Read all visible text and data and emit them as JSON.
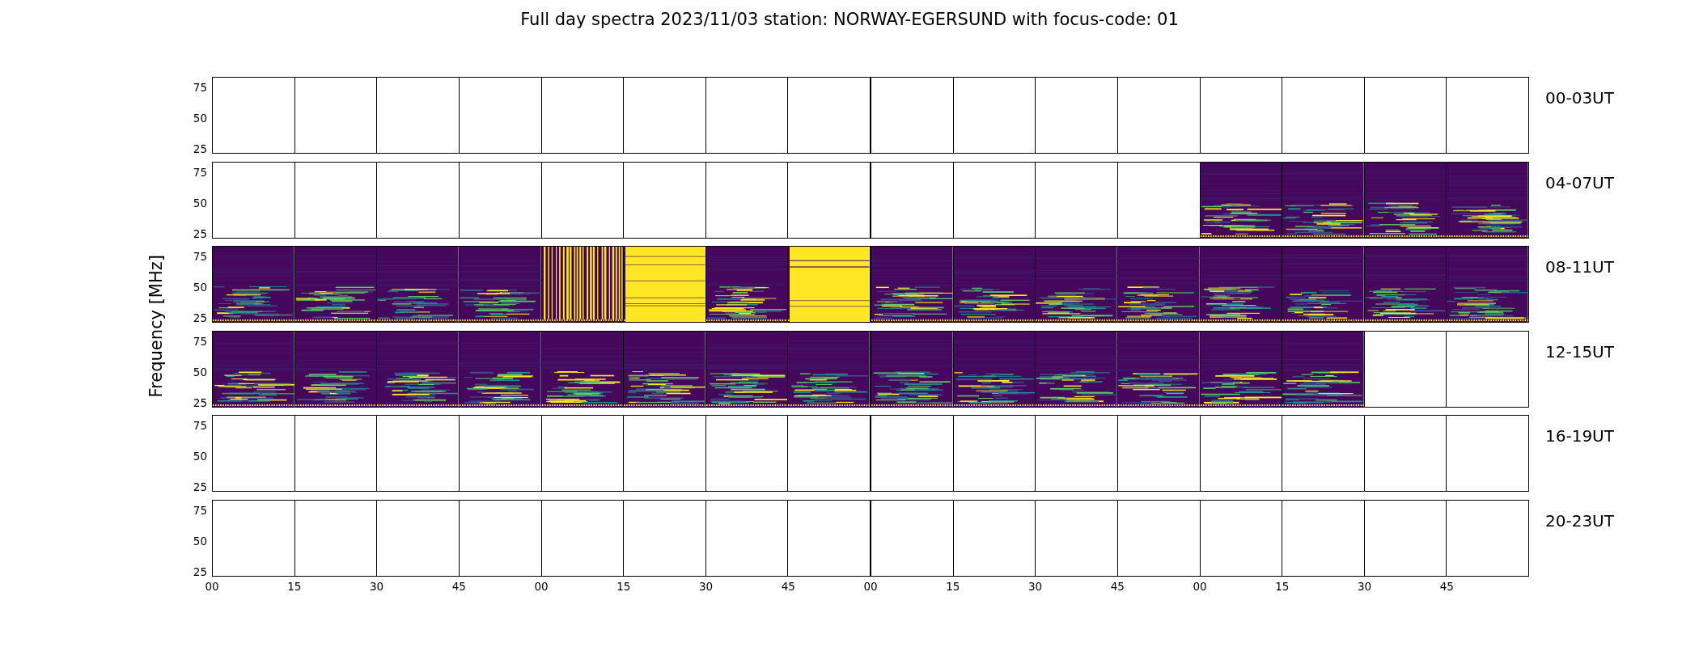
{
  "title": "Full day spectra 2023/11/03 station: NORWAY-EGERSUND with focus-code: 01",
  "y_axis_label": "Frequency [MHz]",
  "rows": [
    {
      "label": "00-03UT",
      "y_ticks": [
        "75",
        "50",
        "25"
      ],
      "panels": [
        {
          "kind": "blank"
        },
        {
          "kind": "blank"
        },
        {
          "kind": "blank"
        },
        {
          "kind": "blank"
        },
        {
          "kind": "blank"
        },
        {
          "kind": "blank"
        },
        {
          "kind": "blank"
        },
        {
          "kind": "blank"
        },
        {
          "kind": "blank"
        },
        {
          "kind": "blank"
        },
        {
          "kind": "blank"
        },
        {
          "kind": "blank"
        },
        {
          "kind": "blank"
        },
        {
          "kind": "blank"
        },
        {
          "kind": "blank"
        },
        {
          "kind": "blank"
        }
      ]
    },
    {
      "label": "04-07UT",
      "y_ticks": [
        "75",
        "50",
        "25"
      ],
      "panels": [
        {
          "kind": "blank"
        },
        {
          "kind": "blank"
        },
        {
          "kind": "blank"
        },
        {
          "kind": "blank"
        },
        {
          "kind": "blank"
        },
        {
          "kind": "blank"
        },
        {
          "kind": "blank"
        },
        {
          "kind": "blank"
        },
        {
          "kind": "blank"
        },
        {
          "kind": "blank"
        },
        {
          "kind": "blank"
        },
        {
          "kind": "blank"
        },
        {
          "kind": "spectrum"
        },
        {
          "kind": "spectrum"
        },
        {
          "kind": "spectrum"
        },
        {
          "kind": "spectrum"
        }
      ]
    },
    {
      "label": "08-11UT",
      "y_ticks": [
        "75",
        "50",
        "25"
      ],
      "panels": [
        {
          "kind": "spectrum"
        },
        {
          "kind": "spectrum"
        },
        {
          "kind": "spectrum"
        },
        {
          "kind": "spectrum"
        },
        {
          "kind": "striped"
        },
        {
          "kind": "saturated"
        },
        {
          "kind": "spectrum"
        },
        {
          "kind": "saturated"
        },
        {
          "kind": "spectrum"
        },
        {
          "kind": "spectrum"
        },
        {
          "kind": "spectrum"
        },
        {
          "kind": "spectrum"
        },
        {
          "kind": "spectrum"
        },
        {
          "kind": "spectrum"
        },
        {
          "kind": "spectrum"
        },
        {
          "kind": "spectrum"
        }
      ]
    },
    {
      "label": "12-15UT",
      "y_ticks": [
        "75",
        "50",
        "25"
      ],
      "panels": [
        {
          "kind": "spectrum"
        },
        {
          "kind": "spectrum"
        },
        {
          "kind": "spectrum"
        },
        {
          "kind": "spectrum"
        },
        {
          "kind": "spectrum"
        },
        {
          "kind": "spectrum"
        },
        {
          "kind": "spectrum"
        },
        {
          "kind": "spectrum"
        },
        {
          "kind": "spectrum"
        },
        {
          "kind": "spectrum"
        },
        {
          "kind": "spectrum"
        },
        {
          "kind": "spectrum"
        },
        {
          "kind": "spectrum"
        },
        {
          "kind": "spectrum"
        },
        {
          "kind": "blank"
        },
        {
          "kind": "blank"
        }
      ]
    },
    {
      "label": "16-19UT",
      "y_ticks": [
        "75",
        "50",
        "25"
      ],
      "panels": [
        {
          "kind": "blank"
        },
        {
          "kind": "blank"
        },
        {
          "kind": "blank"
        },
        {
          "kind": "blank"
        },
        {
          "kind": "blank"
        },
        {
          "kind": "blank"
        },
        {
          "kind": "blank"
        },
        {
          "kind": "blank"
        },
        {
          "kind": "blank"
        },
        {
          "kind": "blank"
        },
        {
          "kind": "blank"
        },
        {
          "kind": "blank"
        },
        {
          "kind": "blank"
        },
        {
          "kind": "blank"
        },
        {
          "kind": "blank"
        },
        {
          "kind": "blank"
        }
      ]
    },
    {
      "label": "20-23UT",
      "y_ticks": [
        "75",
        "50",
        "25"
      ],
      "panels": [
        {
          "kind": "blank"
        },
        {
          "kind": "blank"
        },
        {
          "kind": "blank"
        },
        {
          "kind": "blank"
        },
        {
          "kind": "blank"
        },
        {
          "kind": "blank"
        },
        {
          "kind": "blank"
        },
        {
          "kind": "blank"
        },
        {
          "kind": "blank"
        },
        {
          "kind": "blank"
        },
        {
          "kind": "blank"
        },
        {
          "kind": "blank"
        },
        {
          "kind": "blank"
        },
        {
          "kind": "blank"
        },
        {
          "kind": "blank"
        },
        {
          "kind": "blank"
        }
      ]
    }
  ],
  "x_ticks": [
    "00",
    "15",
    "30",
    "45",
    "00",
    "15",
    "30",
    "45",
    "00",
    "15",
    "30",
    "45",
    "00",
    "15",
    "30",
    "45"
  ]
}
